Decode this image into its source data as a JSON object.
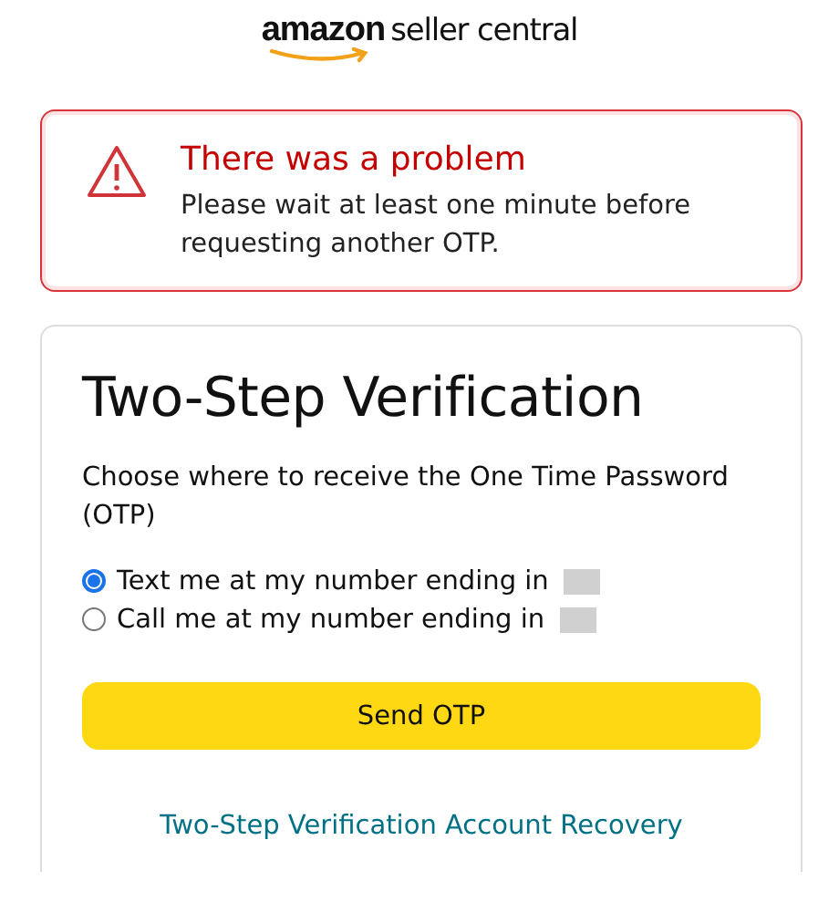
{
  "logo": {
    "brand": "amazon",
    "product": "seller central"
  },
  "alert": {
    "title": "There was a problem",
    "message": "Please wait at least one minute before requesting another OTP."
  },
  "card": {
    "title": "Two-Step Verification",
    "prompt": "Choose where to receive the One Time Password (OTP)",
    "options": [
      {
        "label": "Text me at my number ending in",
        "selected": true
      },
      {
        "label": "Call me at my number ending in",
        "selected": false
      }
    ],
    "submit": "Send OTP",
    "recovery_link": "Two-Step Verification Account Recovery"
  }
}
